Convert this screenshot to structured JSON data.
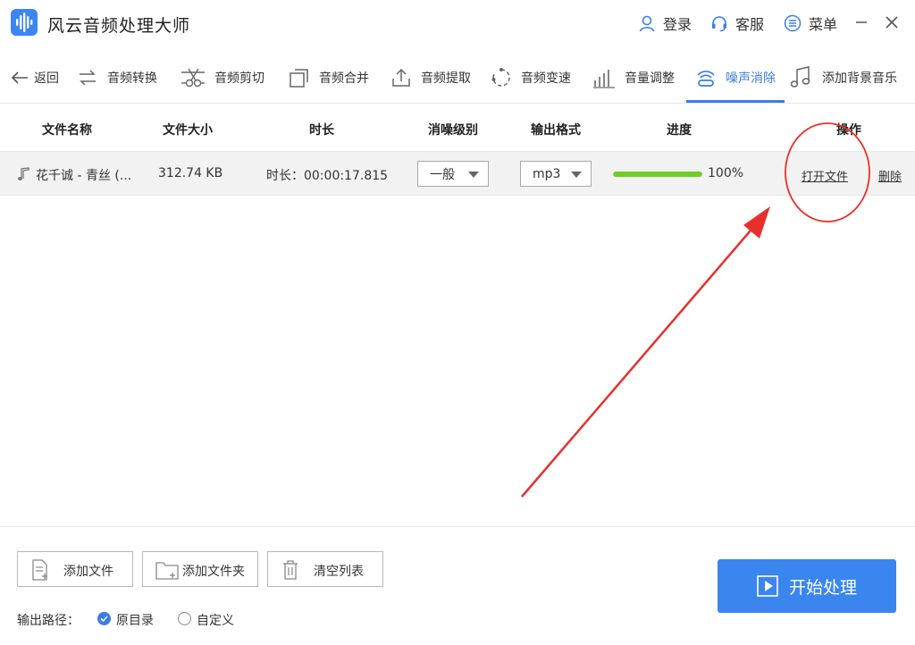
{
  "app": {
    "title": "风云音频处理大师"
  },
  "header": {
    "login": "登录",
    "service": "客服",
    "menu": "菜单"
  },
  "toolbar": {
    "back": "返回",
    "items": [
      "音频转换",
      "音频剪切",
      "音频合并",
      "音频提取",
      "音频变速",
      "音量调整",
      "噪声消除",
      "添加背景音乐"
    ],
    "active_index": 6
  },
  "table": {
    "headers": [
      "文件名称",
      "文件大小",
      "时长",
      "消噪级别",
      "输出格式",
      "进度",
      "操作"
    ],
    "rows": [
      {
        "name": "花千诚 - 青丝 (...",
        "size": "312.74 KB",
        "duration_label": "时长：00:00:17.815",
        "noise_level": "一般",
        "format": "mp3",
        "progress": 100,
        "progress_text": "100%",
        "open": "打开文件",
        "delete": "删除"
      }
    ]
  },
  "bottom": {
    "add_file": "添加文件",
    "add_folder": "添加文件夹",
    "clear_list": "清空列表",
    "start": "开始处理",
    "output_path_label": "输出路径：",
    "radio_original": "原目录",
    "radio_custom": "自定义"
  },
  "colors": {
    "accent": "#3a7de8",
    "progress": "#6ecf24",
    "start_button": "#3a86ee",
    "annotation": "#e8302a"
  }
}
